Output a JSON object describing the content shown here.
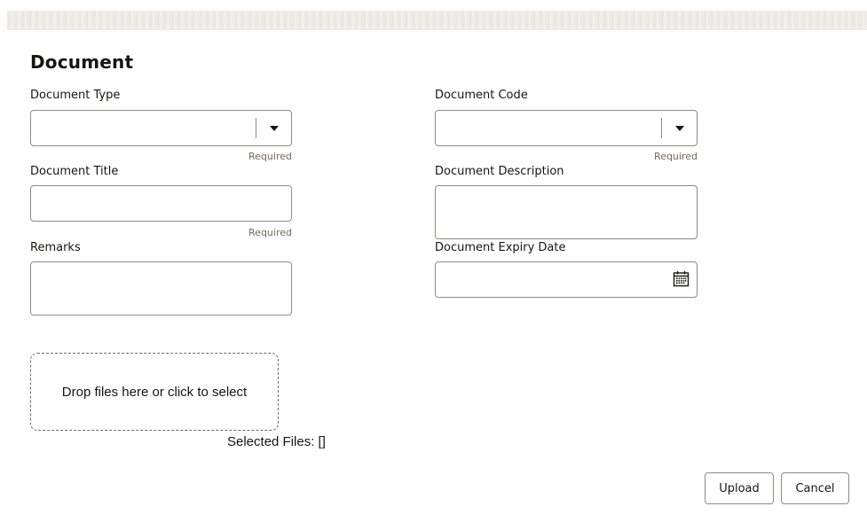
{
  "form": {
    "title": "Document",
    "document_type": {
      "label": "Document Type",
      "value": "",
      "required_text": "Required"
    },
    "document_code": {
      "label": "Document Code",
      "value": "",
      "required_text": "Required"
    },
    "document_title": {
      "label": "Document Title",
      "value": "",
      "required_text": "Required"
    },
    "document_description": {
      "label": "Document Description",
      "value": ""
    },
    "remarks": {
      "label": "Remarks",
      "value": ""
    },
    "document_expiry_date": {
      "label": "Document Expiry Date",
      "value": "",
      "icon": "calendar-icon"
    }
  },
  "upload": {
    "drop_zone_text": "Drop files here or click to select",
    "selected_files_text": "Selected Files: []"
  },
  "actions": {
    "upload_label": "Upload",
    "cancel_label": "Cancel"
  },
  "colors": {
    "border": "#8f8a85",
    "text": "#161513",
    "muted": "#6f6a64"
  }
}
